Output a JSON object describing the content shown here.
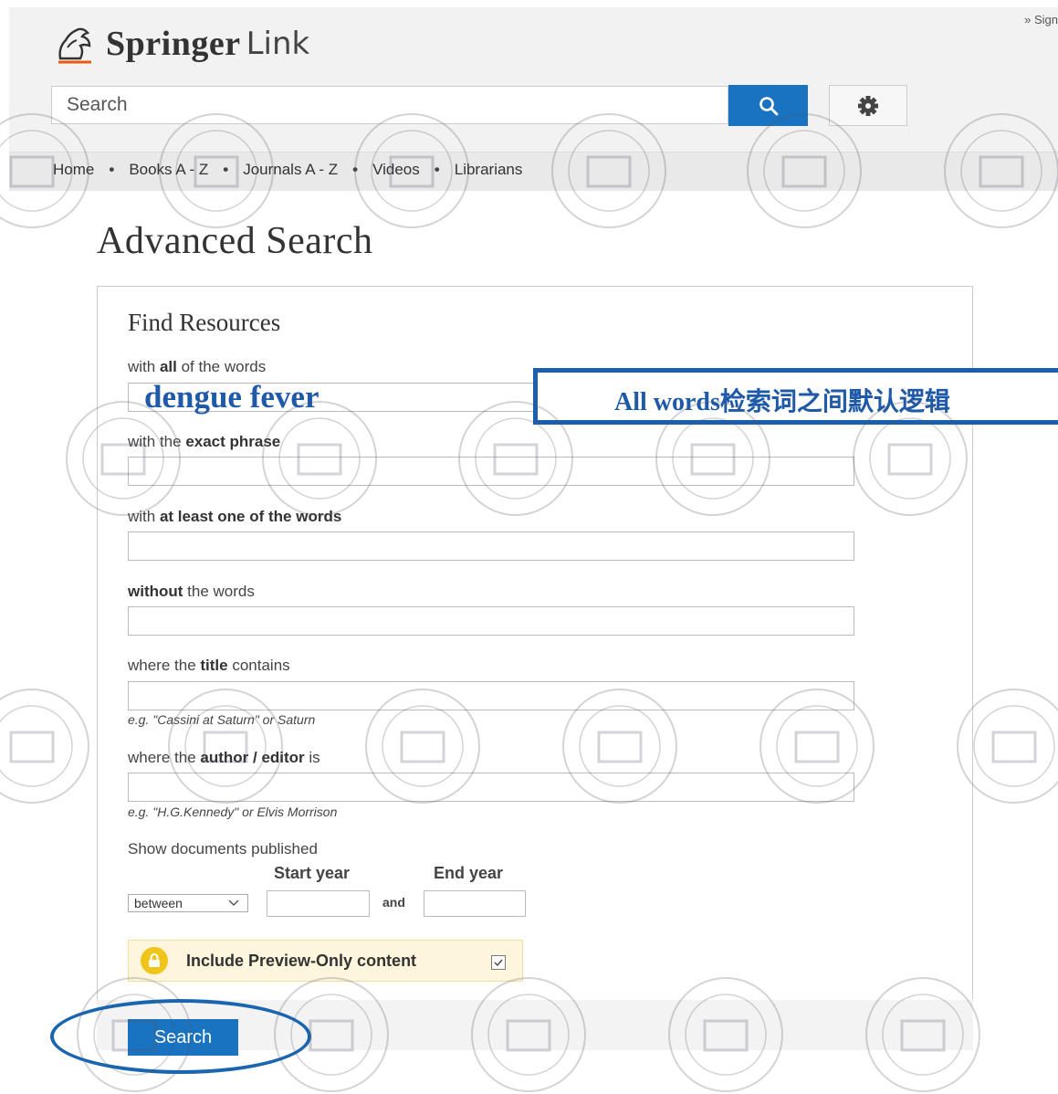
{
  "header": {
    "signin": "» Sign",
    "brand_springer": "Springer",
    "brand_link": "Link",
    "search_placeholder": "Search"
  },
  "nav": {
    "items": [
      "Home",
      "Books A - Z",
      "Journals A - Z",
      "Videos",
      "Librarians"
    ],
    "separator": "•"
  },
  "page_title": "Advanced Search",
  "form": {
    "section_title": "Find Resources",
    "all_words": {
      "pre": "with ",
      "bold": "all",
      "post": " of the words",
      "value": "dengue fever"
    },
    "exact_phrase": {
      "pre": "with the ",
      "bold": "exact phrase",
      "post": ""
    },
    "at_least_one": {
      "pre": "with ",
      "bold": "at least one of the words",
      "post": ""
    },
    "without": {
      "pre": "",
      "bold": "without",
      "post": " the words"
    },
    "title": {
      "pre": "where the ",
      "bold": "title",
      "post": " contains",
      "hint": "e.g. \"Cassini at Saturn\" or Saturn"
    },
    "author": {
      "pre": "where the ",
      "bold": "author / editor",
      "post": " is",
      "hint": "e.g. \"H.G.Kennedy\" or Elvis Morrison"
    },
    "published": {
      "label": "Show documents published",
      "start_label": "Start year",
      "end_label": "End year",
      "range_value": "between",
      "and_label": "and"
    },
    "preview_label": "Include Preview-Only content",
    "submit_label": "Search"
  },
  "annotation": {
    "callout": "All words检索词之间默认逻辑"
  },
  "colors": {
    "accent": "#1a73c0",
    "annotation": "#1e5aa8",
    "preview_bg": "#fdf6dc",
    "lock": "#f0c419"
  }
}
